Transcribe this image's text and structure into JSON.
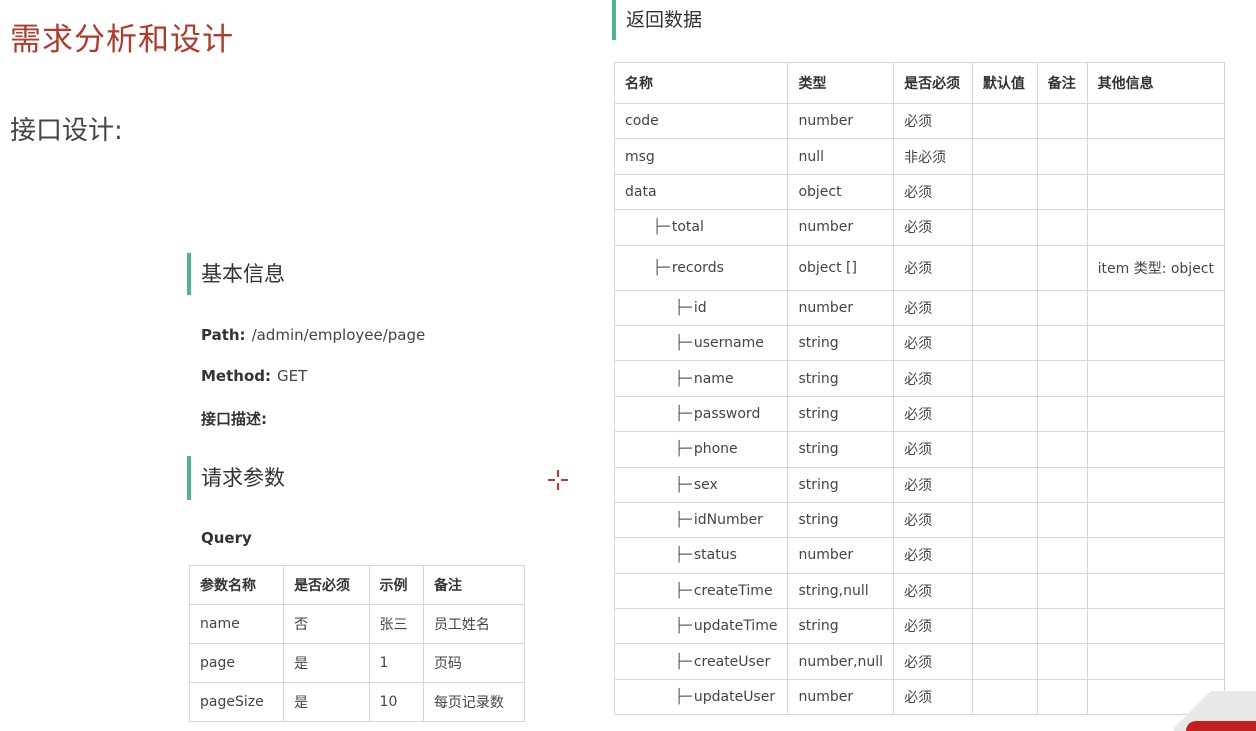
{
  "page": {
    "title": "需求分析和设计",
    "subtitle": "接口设计:"
  },
  "basic_info": {
    "heading": "基本信息",
    "path_label": "Path:",
    "path_value": "/admin/employee/page",
    "method_label": "Method:",
    "method_value": "GET",
    "desc_label": "接口描述:"
  },
  "request_params": {
    "heading": "请求参数",
    "query_label": "Query",
    "columns": [
      "参数名称",
      "是否必须",
      "示例",
      "备注"
    ],
    "rows": [
      [
        "name",
        "否",
        "张三",
        "员工姓名"
      ],
      [
        "page",
        "是",
        "1",
        "页码"
      ],
      [
        "pageSize",
        "是",
        "10",
        "每页记录数"
      ]
    ]
  },
  "response": {
    "heading": "返回数据",
    "columns": [
      "名称",
      "类型",
      "是否必须",
      "默认值",
      "备注",
      "其他信息"
    ],
    "tree_glyph": "├─",
    "rows": [
      {
        "name": "code",
        "type": "number",
        "required": "必须",
        "default": "",
        "note": "",
        "other": ""
      },
      {
        "name": "msg",
        "type": "null",
        "required": "非必须",
        "default": "",
        "note": "",
        "other": ""
      },
      {
        "name": "data",
        "type": "object",
        "required": "必须",
        "default": "",
        "note": "",
        "other": ""
      },
      {
        "name": "total",
        "type": "number",
        "required": "必须",
        "default": "",
        "note": "",
        "other": ""
      },
      {
        "name": "records",
        "type": "object []",
        "required": "必须",
        "default": "",
        "note": "",
        "other": "item 类型: object"
      },
      {
        "name": "id",
        "type": "number",
        "required": "必须",
        "default": "",
        "note": "",
        "other": ""
      },
      {
        "name": "username",
        "type": "string",
        "required": "必须",
        "default": "",
        "note": "",
        "other": ""
      },
      {
        "name": "name",
        "type": "string",
        "required": "必须",
        "default": "",
        "note": "",
        "other": ""
      },
      {
        "name": "password",
        "type": "string",
        "required": "必须",
        "default": "",
        "note": "",
        "other": ""
      },
      {
        "name": "phone",
        "type": "string",
        "required": "必须",
        "default": "",
        "note": "",
        "other": ""
      },
      {
        "name": "sex",
        "type": "string",
        "required": "必须",
        "default": "",
        "note": "",
        "other": ""
      },
      {
        "name": "idNumber",
        "type": "string",
        "required": "必须",
        "default": "",
        "note": "",
        "other": ""
      },
      {
        "name": "status",
        "type": "number",
        "required": "必须",
        "default": "",
        "note": "",
        "other": ""
      },
      {
        "name": "createTime",
        "type": "string,null",
        "required": "必须",
        "default": "",
        "note": "",
        "other": ""
      },
      {
        "name": "updateTime",
        "type": "string",
        "required": "必须",
        "default": "",
        "note": "",
        "other": ""
      },
      {
        "name": "createUser",
        "type": "number,null",
        "required": "必须",
        "default": "",
        "note": "",
        "other": ""
      },
      {
        "name": "updateUser",
        "type": "number",
        "required": "必须",
        "default": "",
        "note": "",
        "other": ""
      }
    ]
  },
  "colors": {
    "title": "#b13a2a",
    "section_accent": "#4fb58a",
    "cursor_mark": "#c0392b"
  },
  "icons": {
    "cursor": "crosshair-cursor-icon"
  }
}
